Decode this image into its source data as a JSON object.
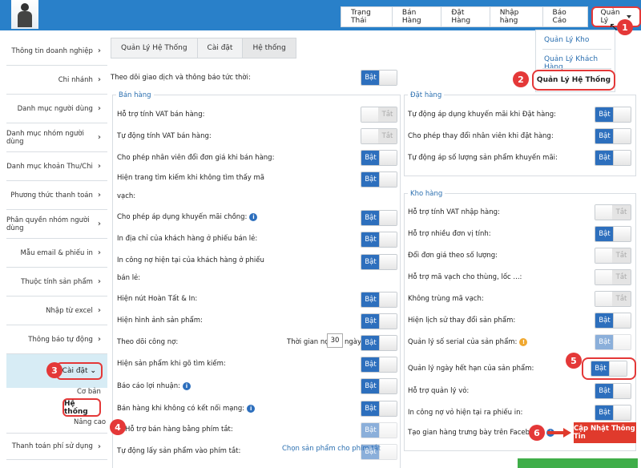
{
  "topnav": {
    "tabs": [
      "Trạng Thái",
      "Bán Hàng",
      "Đặt Hàng",
      "Nhập hàng",
      "Báo Cáo"
    ],
    "active_tab": "Quản Lý"
  },
  "dropdown": {
    "items": [
      "Quản Lý Kho",
      "Quản Lý Khách Hàng"
    ],
    "selected": "Quản Lý Hệ Thống"
  },
  "badges": [
    "1",
    "2",
    "3",
    "4",
    "5",
    "6"
  ],
  "sidebar": {
    "items": [
      "Thông tin doanh nghiệp",
      "Chi nhánh",
      "Danh mục người dùng",
      "Danh mục nhóm người dùng",
      "Danh mục khoản Thu/Chi",
      "Phương thức thanh toán",
      "Phân quyền nhóm người dùng",
      "Mẫu email & phiếu in",
      "Thuộc tính sản phẩm",
      "Nhập từ excel",
      "Thông báo tự động"
    ],
    "active": "Cài đặt",
    "sub_items": [
      "Cơ bản",
      "Hệ thống",
      "Nâng cao"
    ],
    "after": "Thanh toán phí sử dụng"
  },
  "breadcrumb": [
    "Quản Lý Hệ Thống",
    "Cài đặt",
    "Hệ thống"
  ],
  "top_setting": {
    "label": "Theo dõi giao dịch và thông báo tức thời:",
    "state": "Bật"
  },
  "ban_hang": {
    "title": "Bán hàng",
    "rows": [
      {
        "label": "Hỗ trợ tính VAT bán hàng:",
        "state": "Tắt"
      },
      {
        "label": "Tự động tính VAT bán hàng:",
        "state": "Tắt"
      },
      {
        "label": "Cho phép nhân viên đổi đơn giá khi bán hàng:",
        "state": "Bật"
      },
      {
        "label": "Hiện trang tìm kiếm khi không tìm thấy mã",
        "label2": "vạch:",
        "state": "Bật"
      },
      {
        "label": "Cho phép áp dụng khuyến mãi chồng:",
        "state": "Bật"
      },
      {
        "label": "In địa chỉ của khách hàng ở phiếu bán lẻ:",
        "state": "Bật"
      },
      {
        "label": "In công nợ hiện tại của khách hàng ở phiếu",
        "label2": "bán lẻ:",
        "state": "Bật"
      },
      {
        "label": "Hiện nút Hoàn Tất & In:",
        "state": "Bật"
      },
      {
        "label": "Hiện hình ảnh sản phẩm:",
        "state": "Bật"
      },
      {
        "label": "Theo dõi công nợ:",
        "state": "Bật"
      },
      {
        "label": "Hiện sản phẩm khi gõ tìm kiếm:",
        "state": "Bật"
      },
      {
        "label": "Báo cáo lợi nhuận:",
        "state": "Bật"
      },
      {
        "label": "Bán hàng khi không có kết nối mạng:",
        "state": "Bật"
      },
      {
        "label": "Hỗ trợ bán hàng bằng phím tắt:",
        "state": "Bật"
      },
      {
        "label": "Tự động lấy sản phẩm vào phím tắt:",
        "state": "Bật"
      }
    ],
    "debt_time_label": "Thời gian nợ:",
    "debt_time_value": "30",
    "debt_time_unit": "ngày",
    "shortcut_link": "Chọn sản phẩm cho phím tắt"
  },
  "dat_hang": {
    "title": "Đặt hàng",
    "rows": [
      {
        "label": "Tự động áp dụng khuyến mãi khi Đặt hàng:",
        "state": "Bật"
      },
      {
        "label": "Cho phép thay đổi nhân viên khi đặt hàng:",
        "state": "Bật"
      },
      {
        "label": "Tự động áp số lượng sản phẩm khuyến mãi:",
        "state": "Bật"
      }
    ]
  },
  "kho_hang": {
    "title": "Kho hàng",
    "rows": [
      {
        "label": "Hỗ trợ tính VAT nhập hàng:",
        "state": "Tắt"
      },
      {
        "label": "Hỗ trợ nhiều đơn vị tính:",
        "state": "Bật"
      },
      {
        "label": "Đổi đơn giá theo số lượng:",
        "state": "Tắt"
      },
      {
        "label": "Hỗ trợ mã vạch cho thùng, lốc ...:",
        "state": "Tắt"
      },
      {
        "label": "Không trùng mã vạch:",
        "state": "Tắt"
      },
      {
        "label": "Hiện lịch sử thay đổi sản phẩm:",
        "state": "Bật"
      },
      {
        "label": "Quản lý số serial của sản phẩm:",
        "state": "Bật"
      },
      {
        "label": "Quản lý ngày hết hạn của sản phẩm:",
        "state": "Bật"
      },
      {
        "label": "Hỗ trợ quản lý vỏ:",
        "state": "Bật"
      },
      {
        "label": "In công nợ vỏ hiện tại ra phiếu in:",
        "state": "Bật"
      },
      {
        "label": "Tạo gian hàng trưng bày trên Facebook:"
      }
    ]
  },
  "update_button": "Cập Nhật Thông Tin",
  "info_glyph": "i",
  "warn_glyph": "!"
}
